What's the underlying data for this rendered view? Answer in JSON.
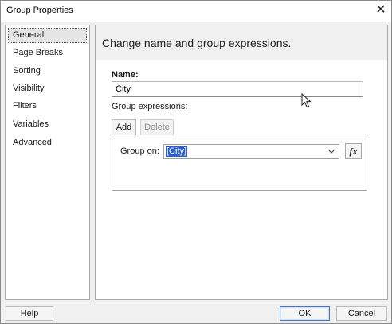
{
  "window": {
    "title": "Group Properties",
    "close_glyph": "✕"
  },
  "sidebar": {
    "items": [
      {
        "label": "General",
        "selected": true
      },
      {
        "label": "Page Breaks",
        "selected": false
      },
      {
        "label": "Sorting",
        "selected": false
      },
      {
        "label": "Visibility",
        "selected": false
      },
      {
        "label": "Filters",
        "selected": false
      },
      {
        "label": "Variables",
        "selected": false
      },
      {
        "label": "Advanced",
        "selected": false
      }
    ]
  },
  "general": {
    "header": "Change name and group expressions.",
    "name_label": "Name:",
    "name_value": "City",
    "group_expressions_label": "Group expressions:",
    "add_label": "Add",
    "delete_label": "Delete",
    "delete_enabled": false,
    "group_on_label": "Group on:",
    "group_on_value": "[City]",
    "fx_label": "fx"
  },
  "footer": {
    "help_label": "Help",
    "ok_label": "OK",
    "cancel_label": "Cancel"
  },
  "icons": {
    "close": "close-icon",
    "dropdown": "chevron-down-icon",
    "expression": "function-icon",
    "pointer": "mouse-pointer-icon"
  },
  "colors": {
    "selection": "#2b5fcc",
    "default_button_border": "#3c78d8"
  }
}
